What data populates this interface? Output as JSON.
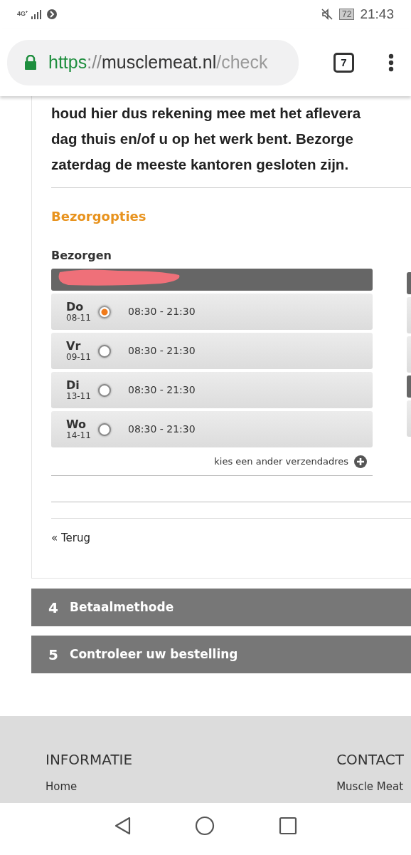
{
  "status_bar": {
    "network": "4G⁺",
    "battery": "72",
    "time": "21:43"
  },
  "browser": {
    "url_scheme": "https",
    "url_sep": "://",
    "url_host": "musclemeat.nl",
    "url_path": "/check",
    "tab_count": "7"
  },
  "notice": "houd hier dus rekening mee met het aflevera\ndag thuis en/of u op het werk bent. Bezorge\nzaterdag de meeste kantoren gesloten zijn.",
  "section_title": "Bezorgopties",
  "delivery": {
    "heading": "Bezorgen",
    "slots": [
      {
        "day": "Do",
        "date": "08-11",
        "time": "08:30 - 21:30",
        "selected": true
      },
      {
        "day": "Vr",
        "date": "09-11",
        "time": "08:30 - 21:30",
        "selected": false
      },
      {
        "day": "Di",
        "date": "13-11",
        "time": "08:30 - 21:30",
        "selected": false
      },
      {
        "day": "Wo",
        "date": "14-11",
        "time": "08:30 - 21:30",
        "selected": false
      }
    ],
    "other_address": "kies een ander verzendadres"
  },
  "back_link": "« Terug",
  "steps": [
    {
      "number": "4",
      "title": "Betaalmethode"
    },
    {
      "number": "5",
      "title": "Controleer uw bestelling"
    }
  ],
  "footer": {
    "columns": [
      {
        "title": "INFORMATIE",
        "link": "Home"
      },
      {
        "title": "CONTACT",
        "link": "Muscle Meat"
      }
    ]
  }
}
